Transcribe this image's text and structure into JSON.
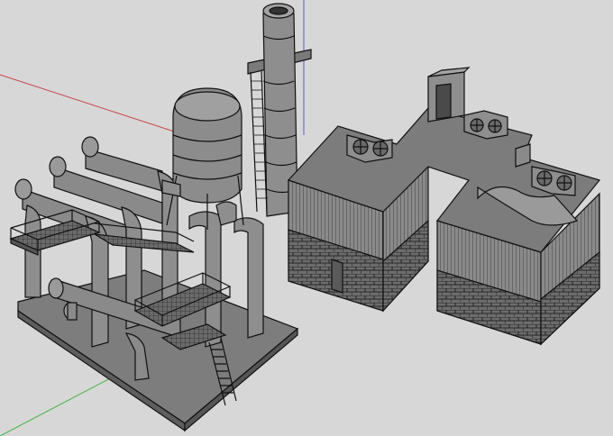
{
  "app": {
    "viewport_background": "#d7d7d7"
  },
  "axes": {
    "red_axis_color": "#c84646",
    "green_axis_color": "#46b446",
    "blue_axis_color": "#5a5ad2"
  },
  "model": {
    "face_color": "#7a7a7a",
    "face_light": "#9a9a9a",
    "face_dark": "#5a5a5a",
    "edge_color": "#101010",
    "icons": [
      "pipe-rack-icon",
      "storage-tank-icon",
      "chimney-stack-icon",
      "warehouse-icon",
      "fan-unit-icon"
    ]
  }
}
